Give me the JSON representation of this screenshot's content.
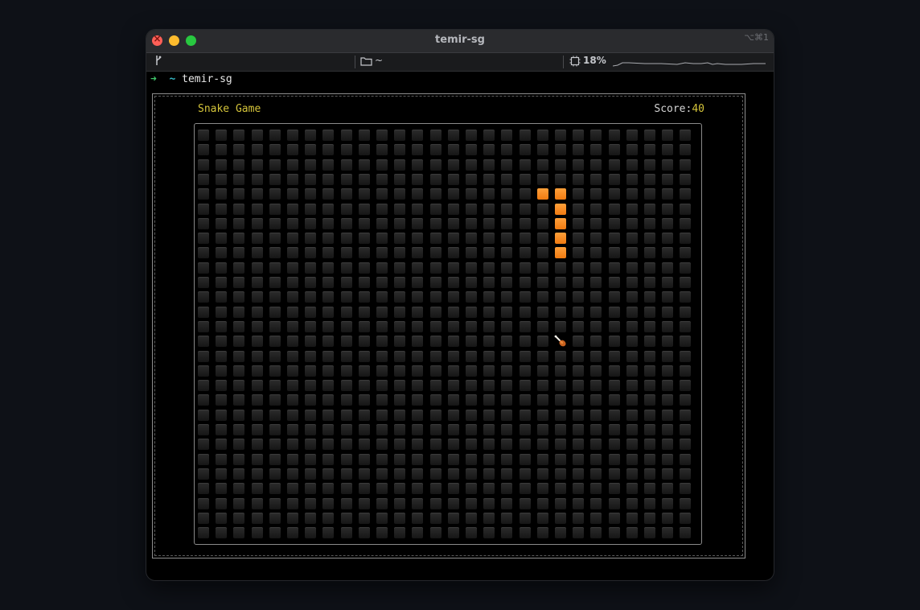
{
  "window": {
    "title": "temir-sg",
    "shortcut": "⌥⌘1"
  },
  "statusbar": {
    "branch_icon": "git-branch-icon",
    "folder_label": "~",
    "cpu_label": "18%"
  },
  "prompt": {
    "arrow": "➜",
    "path": "~",
    "command": "temir-sg"
  },
  "game": {
    "title": "Snake Game",
    "score_label": "Score:",
    "score_value": "40",
    "grid": {
      "cols": 28,
      "rows": 28
    },
    "snake": [
      [
        20,
        4
      ],
      [
        19,
        4
      ],
      [
        20,
        5
      ],
      [
        20,
        6
      ],
      [
        20,
        7
      ],
      [
        20,
        8
      ]
    ],
    "food": [
      20,
      14
    ],
    "food_icon": "drumstick-icon"
  },
  "colors": {
    "snake": "#f5891e",
    "accent_title": "#d4c43a",
    "empty_cell": "#222222"
  }
}
